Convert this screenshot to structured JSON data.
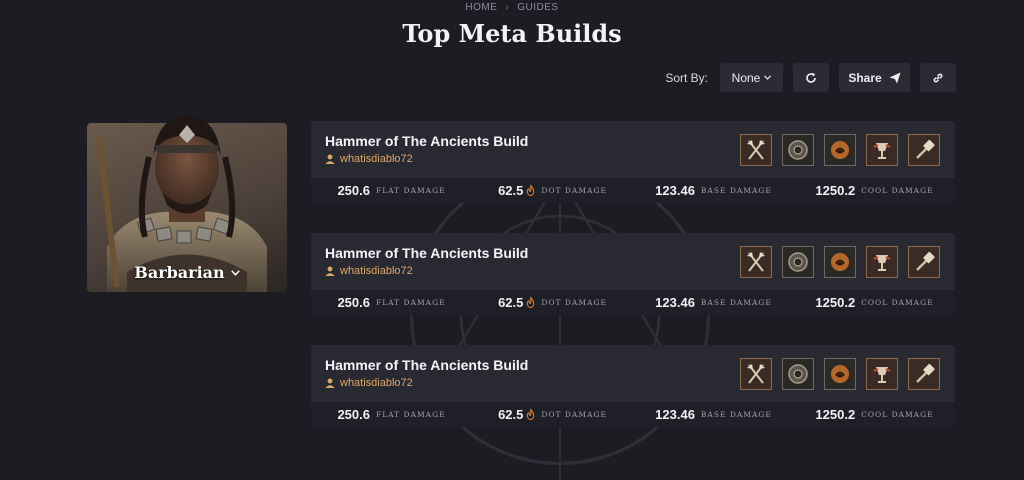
{
  "breadcrumb": {
    "home": "HOME",
    "guides": "GUIDES"
  },
  "page_title": "Top Meta Builds",
  "toolbar": {
    "sort_label": "Sort By:",
    "sort_value": "None",
    "share_label": "Share"
  },
  "hero": {
    "name": "Barbarian"
  },
  "builds": [
    {
      "title": "Hammer of The Ancients Build",
      "author": "whatisdiablo72",
      "stats": [
        {
          "value": "250.6",
          "label": "FLAT DAMAGE"
        },
        {
          "value": "62.5",
          "label": "DOT DAMAGE"
        },
        {
          "value": "123.46",
          "label": "BASE DAMAGE"
        },
        {
          "value": "1250.2",
          "label": "COOL DAMAGE"
        }
      ]
    },
    {
      "title": "Hammer of The Ancients Build",
      "author": "whatisdiablo72",
      "stats": [
        {
          "value": "250.6",
          "label": "FLAT DAMAGE"
        },
        {
          "value": "62.5",
          "label": "DOT DAMAGE"
        },
        {
          "value": "123.46",
          "label": "BASE DAMAGE"
        },
        {
          "value": "1250.2",
          "label": "COOL DAMAGE"
        }
      ]
    },
    {
      "title": "Hammer of The Ancients Build",
      "author": "whatisdiablo72",
      "stats": [
        {
          "value": "250.6",
          "label": "FLAT DAMAGE"
        },
        {
          "value": "62.5",
          "label": "DOT DAMAGE"
        },
        {
          "value": "123.46",
          "label": "BASE DAMAGE"
        },
        {
          "value": "1250.2",
          "label": "COOL DAMAGE"
        }
      ]
    }
  ],
  "skill_icons": [
    "axes-skill-icon",
    "war-cry-skill-icon",
    "berserk-skill-icon",
    "chalice-skill-icon",
    "hammer-skill-icon"
  ],
  "colors": {
    "background": "#1c1c23",
    "card": "#292932",
    "author": "#e0a867",
    "skill_border": "#8c6a4b"
  }
}
